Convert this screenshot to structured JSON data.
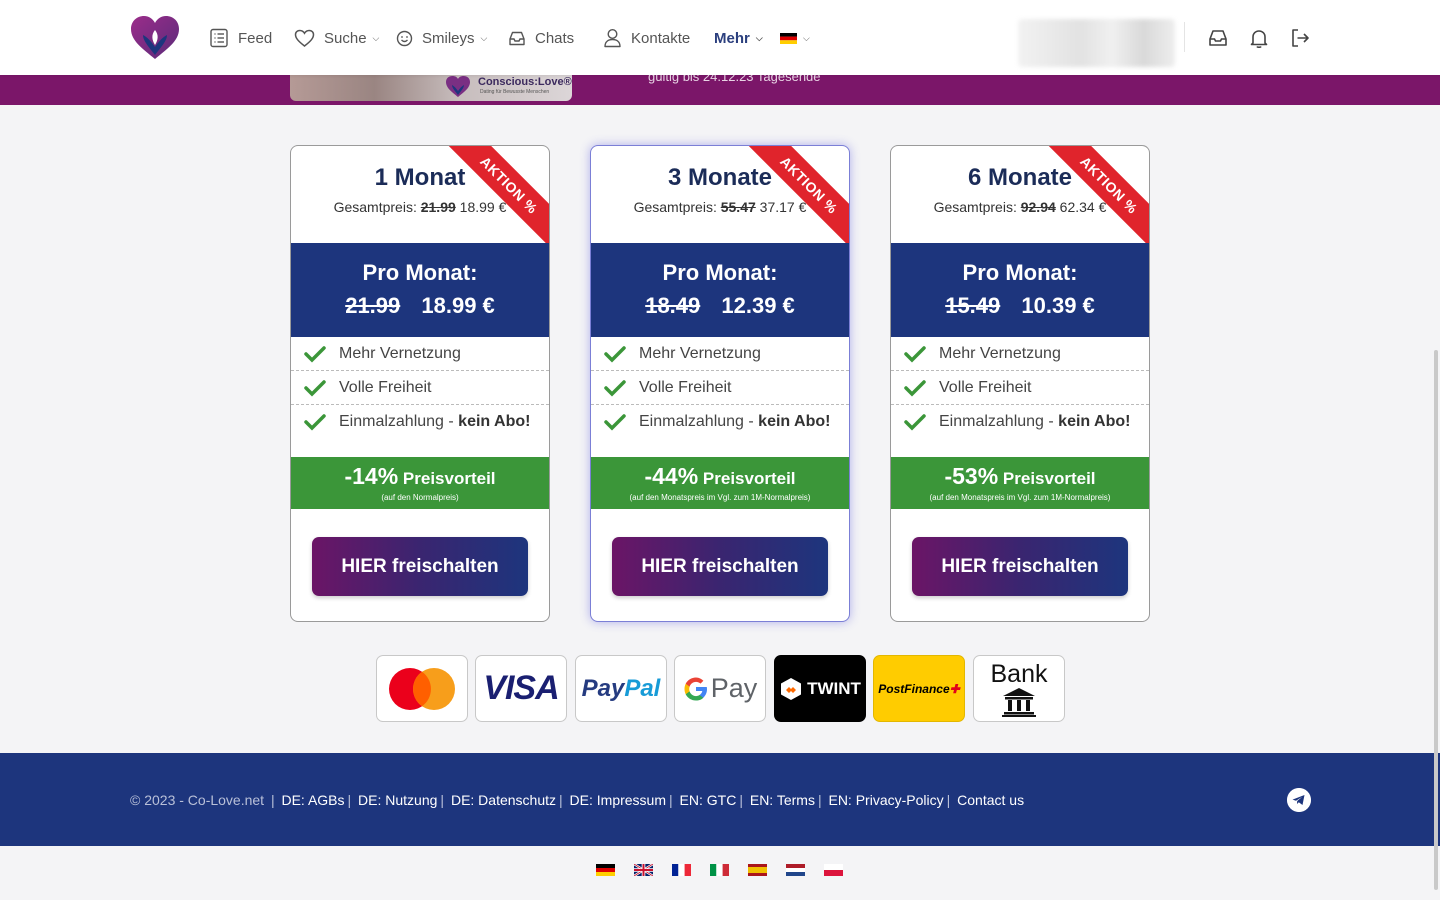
{
  "nav": {
    "items": [
      {
        "label": "Feed",
        "icon": "feed-icon"
      },
      {
        "label": "Suche",
        "icon": "heart-icon"
      },
      {
        "label": "Smileys",
        "icon": "smiley-icon"
      },
      {
        "label": "Chats",
        "icon": "inbox-icon"
      },
      {
        "label": "Kontakte",
        "icon": "user-icon"
      },
      {
        "label": "Mehr",
        "icon": ""
      }
    ],
    "language_flag": "de-flag-icon",
    "right_icons": [
      "inbox-icon",
      "bell-icon",
      "logout-icon"
    ]
  },
  "banner": {
    "brand": "Conscious:Love®",
    "tagline": "Dating für Bewusste Menschen",
    "text": "gültig bis 24.12.23 Tagesende"
  },
  "plans": [
    {
      "title": "1 Monat",
      "total_label": "Gesamtpreis:",
      "total_old": "21.99",
      "total_new": "18.99 €",
      "ribbon": "AKTION %",
      "per_month_label": "Pro Monat:",
      "month_old": "21.99",
      "month_new": "18.99 €",
      "features": [
        "Mehr Vernetzung",
        "Volle Freiheit",
        "Einmalzahlung - "
      ],
      "feature_bold": "kein Abo!",
      "discount_pct": "-14%",
      "discount_label": "Preisvorteil",
      "discount_note": "(auf den Normalpreis)",
      "cta": "HIER freischalten"
    },
    {
      "title": "3 Monate",
      "total_label": "Gesamtpreis:",
      "total_old": "55.47",
      "total_new": "37.17 €",
      "ribbon": "AKTION %",
      "per_month_label": "Pro Monat:",
      "month_old": "18.49",
      "month_new": "12.39 €",
      "features": [
        "Mehr Vernetzung",
        "Volle Freiheit",
        "Einmalzahlung - "
      ],
      "feature_bold": "kein Abo!",
      "discount_pct": "-44%",
      "discount_label": "Preisvorteil",
      "discount_note": "(auf den Monatspreis im Vgl. zum 1M-Normalpreis)",
      "cta": "HIER freischalten"
    },
    {
      "title": "6 Monate",
      "total_label": "Gesamtpreis:",
      "total_old": "92.94",
      "total_new": "62.34 €",
      "ribbon": "AKTION %",
      "per_month_label": "Pro Monat:",
      "month_old": "15.49",
      "month_new": "10.39 €",
      "features": [
        "Mehr Vernetzung",
        "Volle Freiheit",
        "Einmalzahlung - "
      ],
      "feature_bold": "kein Abo!",
      "discount_pct": "-53%",
      "discount_label": "Preisvorteil",
      "discount_note": "(auf den Monatspreis im Vgl. zum 1M-Normalpreis)",
      "cta": "HIER freischalten"
    }
  ],
  "payments": {
    "visa": "VISA",
    "paypal_pay": "Pay",
    "paypal_pal": "Pal",
    "gpay": "Pay",
    "twint": "TWINT",
    "postfinance": "PostFinance",
    "bank": "Bank"
  },
  "footer": {
    "copyright": "© 2023 - Co-Love.net",
    "links": [
      "DE: AGBs",
      "DE: Nutzung",
      "DE: Datenschutz",
      "DE: Impressum",
      "EN: GTC",
      "EN: Terms",
      "EN: Privacy-Policy",
      "Contact us"
    ]
  },
  "languages": [
    "de-flag-icon",
    "uk-flag-icon",
    "fr-flag-icon",
    "it-flag-icon",
    "es-flag-icon",
    "nl-flag-icon",
    "pl-flag-icon"
  ],
  "colors": {
    "brand_purple": "#7b1669",
    "brand_navy": "#1d357d",
    "discount_green": "#3b9639",
    "ribbon_red": "#e0242c"
  }
}
